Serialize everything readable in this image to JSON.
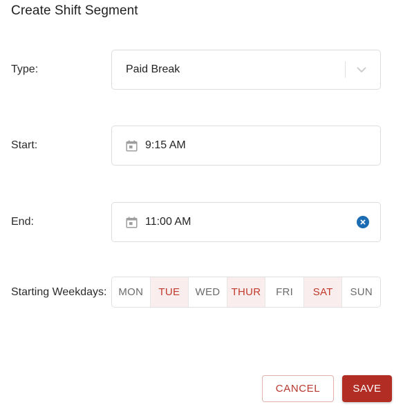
{
  "dialog": {
    "title": "Create Shift Segment"
  },
  "fields": {
    "type": {
      "label": "Type:",
      "value": "Paid Break",
      "icon": "chevron-down-icon"
    },
    "start": {
      "label": "Start:",
      "value": "9:15 AM",
      "icon": "calendar-icon"
    },
    "end": {
      "label": "End:",
      "value": "11:00 AM",
      "icon": "calendar-icon",
      "clear_icon": "clear-circle-icon"
    },
    "weekdays": {
      "label": "Starting Weekdays:",
      "options": [
        {
          "label": "MON",
          "selected": false
        },
        {
          "label": "TUE",
          "selected": true
        },
        {
          "label": "WED",
          "selected": false
        },
        {
          "label": "THUR",
          "selected": true
        },
        {
          "label": "FRI",
          "selected": false
        },
        {
          "label": "SAT",
          "selected": true
        },
        {
          "label": "SUN",
          "selected": false
        }
      ]
    }
  },
  "footer": {
    "cancel_label": "CANCEL",
    "save_label": "SAVE"
  },
  "colors": {
    "accent_red": "#b22e24",
    "selected_text": "#c0392b",
    "selected_bg": "#faeded",
    "cancel_border": "#e3b0ac",
    "clear_blue": "#1b6cb3",
    "border": "#dcdcdc",
    "title_text": "#212121"
  }
}
